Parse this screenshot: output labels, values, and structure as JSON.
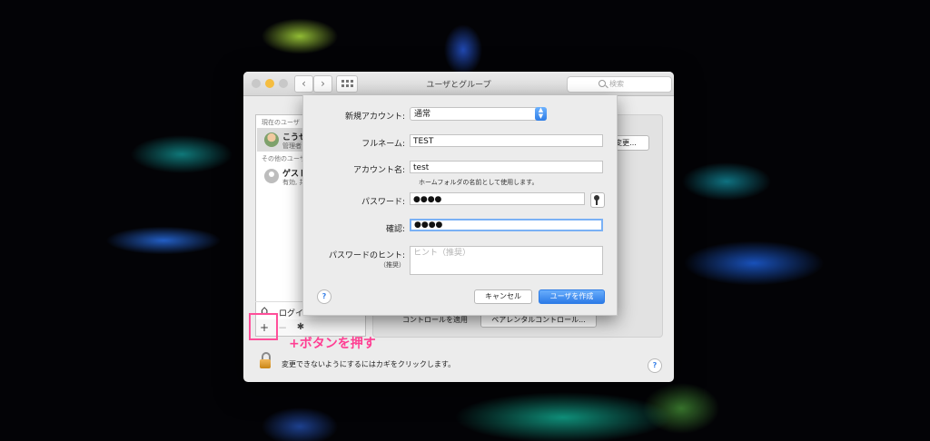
{
  "window": {
    "title": "ユーザとグループ",
    "search_placeholder": "検索"
  },
  "sidebar": {
    "current_users_header": "現在のユーザ",
    "other_users_header": "その他のユーザ",
    "users": [
      {
        "name": "こうせ",
        "role": "管理者",
        "selected": true
      },
      {
        "name": "ゲスト",
        "role": "有効, 共",
        "selected": false
      }
    ],
    "login_label": "ログイ",
    "add_label": "+",
    "remove_label": "−",
    "gear_label": "✱"
  },
  "right_panel": {
    "change_button": "変更...",
    "controls_label": "コントロールを適用",
    "parental_button": "ペアレンタルコントロール..."
  },
  "lock_text": "変更できないようにするにはカギをクリックします。",
  "annotation": "+ボタンを押す",
  "sheet": {
    "new_account_label": "新規アカウント:",
    "new_account_value": "通常",
    "full_name_label": "フルネーム:",
    "full_name_value": "TEST",
    "account_name_label": "アカウント名:",
    "account_name_value": "test",
    "account_name_note": "ホームフォルダの名前として使用します。",
    "password_label": "パスワード:",
    "password_value": "●●●●",
    "verify_label": "確認:",
    "verify_value": "●●●●",
    "hint_label": "パスワードのヒント:",
    "hint_sublabel": "（推奨）",
    "hint_placeholder": "ヒント（推奨）",
    "help": "?",
    "cancel_button": "キャンセル",
    "create_button": "ユーザを作成"
  },
  "help": "?",
  "colors": {
    "accent": "#2f7de6",
    "annotation": "#ff3f93",
    "focus_ring": "#7ab1f5"
  }
}
